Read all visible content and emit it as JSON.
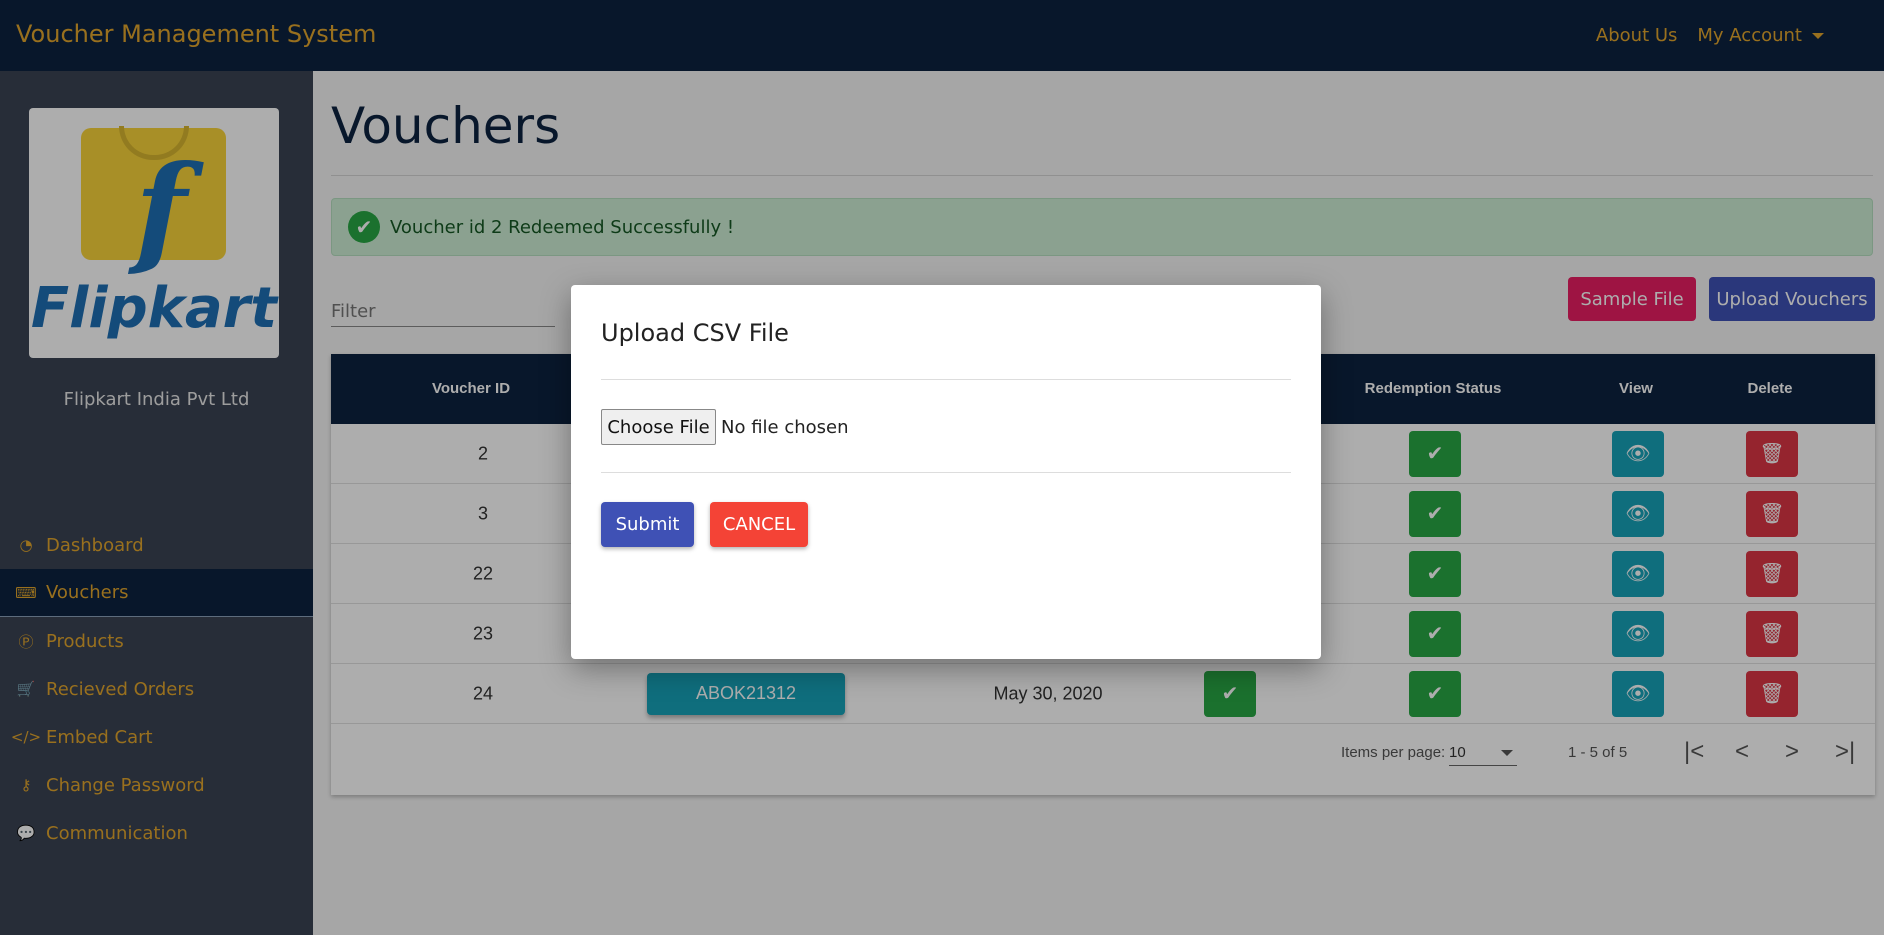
{
  "app": {
    "title": "Voucher Management System"
  },
  "nav": {
    "about": "About Us",
    "account": "My Account"
  },
  "sidebar": {
    "logo_word": "Flipkart",
    "logo_letter": "f",
    "company": "Flipkart India Pvt Ltd",
    "items": [
      {
        "label": "Dashboard",
        "icon": "dashboard-icon",
        "glyph": "◔"
      },
      {
        "label": "Vouchers",
        "icon": "keyboard-icon",
        "glyph": "⌨"
      },
      {
        "label": "Products",
        "icon": "product-icon",
        "glyph": "Ⓟ"
      },
      {
        "label": "Recieved Orders",
        "icon": "cart-icon",
        "glyph": "🛒"
      },
      {
        "label": "Embed Cart",
        "icon": "code-icon",
        "glyph": "</>"
      },
      {
        "label": "Change Password",
        "icon": "key-icon",
        "glyph": "⚷"
      },
      {
        "label": "Communication",
        "icon": "chat-icon",
        "glyph": "💬"
      }
    ]
  },
  "main": {
    "title": "Vouchers",
    "alert": "Voucher id 2 Redeemed Successfully !",
    "filter_placeholder": "Filter",
    "sample_file": "Sample File",
    "upload_vouchers": "Upload Vouchers"
  },
  "table": {
    "headers": {
      "voucher_id": "Voucher ID",
      "redemption_status": "Redemption Status",
      "view": "View",
      "delete": "Delete"
    },
    "rows": [
      {
        "id": "2"
      },
      {
        "id": "3"
      },
      {
        "id": "22"
      },
      {
        "id": "23"
      },
      {
        "id": "24",
        "code": "ABOK21312",
        "date": "May 30, 2020"
      }
    ]
  },
  "paginator": {
    "label": "Items per page:",
    "page_size": "10",
    "range": "1 - 5 of 5",
    "first": "|<",
    "prev": "<",
    "next": ">",
    "last": ">|"
  },
  "icons": {
    "check": "✔",
    "eye": "👁",
    "trash": "🗑"
  },
  "modal": {
    "title": "Upload CSV File",
    "choose_file": "Choose File",
    "no_file": "No file chosen",
    "submit": "Submit",
    "cancel": "CANCEL"
  },
  "colors": {
    "navbar": "#0d2340",
    "accent_gold": "#e2a62d",
    "sidebar": "#3a4353",
    "green": "#28a745",
    "teal": "#17a2b8",
    "red": "#dc3545",
    "indigo": "#3f51b5",
    "pink": "#e91e63"
  }
}
